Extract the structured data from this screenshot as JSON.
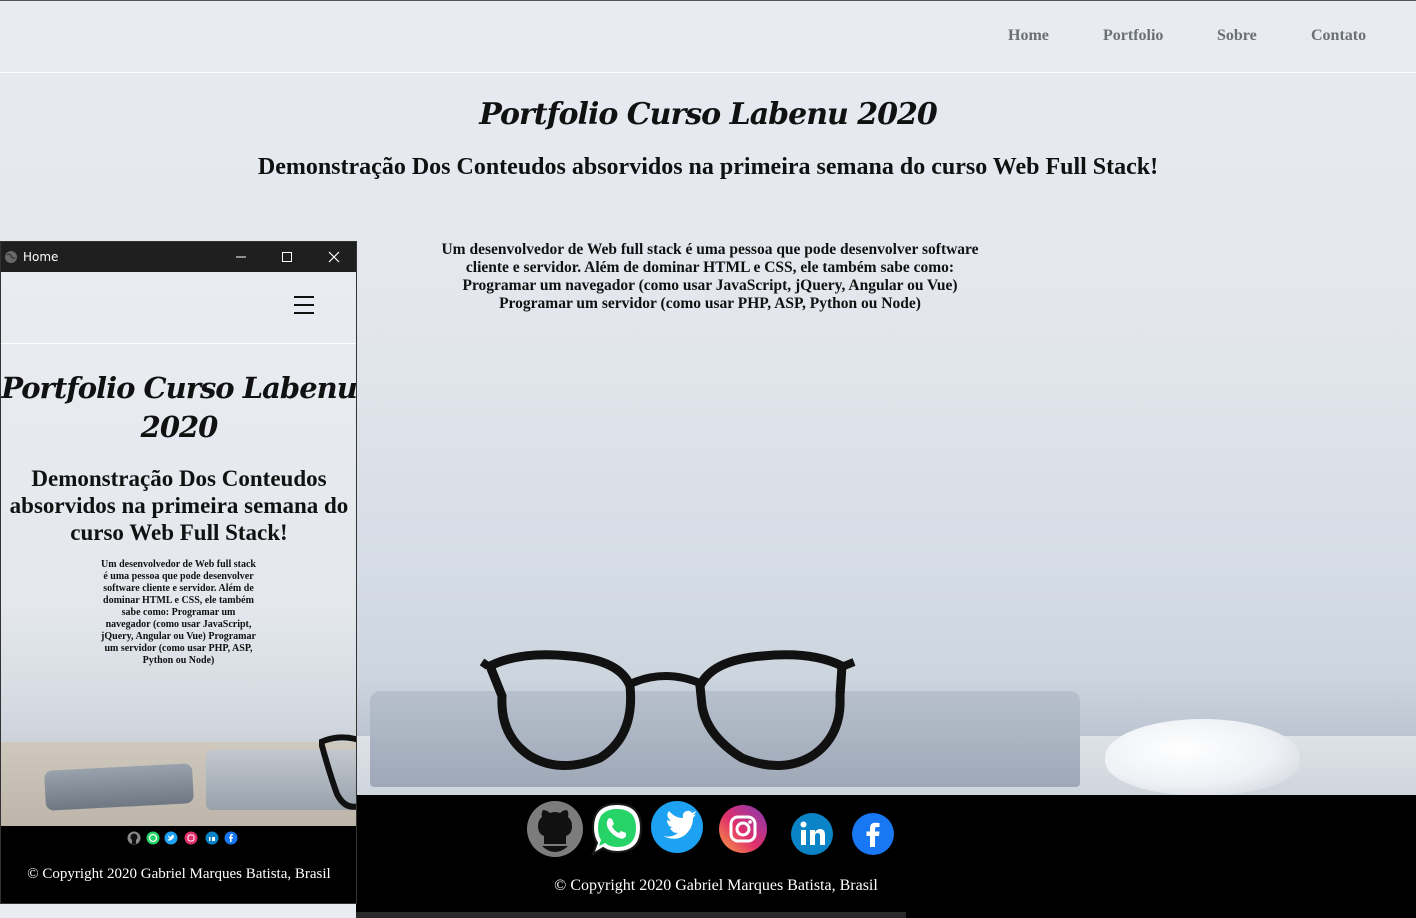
{
  "nav": {
    "home": "Home",
    "portfolio": "Portfolio",
    "sobre": "Sobre",
    "contato": "Contato"
  },
  "page": {
    "title": "Portfolio Curso Labenu 2020",
    "subtitle": "Demonstração Dos Conteudos absorvidos na primeira semana do curso Web Full Stack!",
    "description_lines": [
      "Um desenvolvedor de Web full stack é uma pessoa que pode desenvolver software",
      "cliente e servidor. Além de dominar HTML e CSS, ele também sabe como:",
      "Programar um navegador (como usar JavaScript, jQuery, Angular ou Vue)",
      "Programar um servidor (como usar PHP, ASP, Python ou Node)"
    ],
    "description_full": "Um desenvolvedor de Web full stack é uma pessoa que pode desenvolver software cliente e servidor. Além de dominar HTML e CSS, ele também sabe como: Programar um navegador (como usar JavaScript, jQuery, Angular ou Vue) Programar um servidor (como usar PHP, ASP, Python ou Node)"
  },
  "footer": {
    "copyright": "© Copyright 2020 Gabriel Marques Batista, Brasil",
    "social_icons": [
      "github-icon",
      "whatsapp-icon",
      "twitter-icon",
      "instagram-icon",
      "linkedin-icon",
      "facebook-icon"
    ]
  },
  "window": {
    "title": "Home",
    "controls": [
      "minimize-icon",
      "maximize-icon",
      "close-icon"
    ]
  },
  "colors": {
    "nav_text": "#6b6f76",
    "footer_bg": "#000000",
    "twitter": "#1da1f2",
    "whatsapp": "#25d366",
    "linkedin": "#0a84c6",
    "facebook": "#1877f2"
  }
}
